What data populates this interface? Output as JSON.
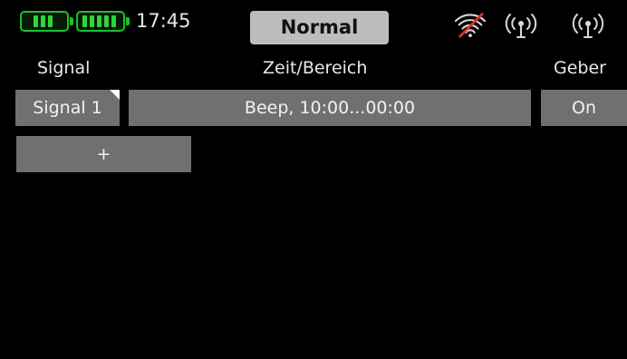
{
  "status_bar": {
    "battery_receiver_icon": "battery-icon",
    "battery_transmitter_icon": "battery-icon",
    "time": "17:45",
    "flight_phase": "Normal",
    "wifi_icon": "wifi-disabled-icon",
    "telemetry_icons": [
      "antenna-signal-icon",
      "antenna-signal-icon"
    ],
    "accent_color": "#1fbf2a"
  },
  "columns": {
    "signal": "Signal",
    "time_range": "Zeit/Bereich",
    "control": "Geber"
  },
  "rows": [
    {
      "signal": "Signal 1",
      "time_range": "Beep, 10:00...00:00",
      "control": "On"
    }
  ],
  "add_label": "+"
}
